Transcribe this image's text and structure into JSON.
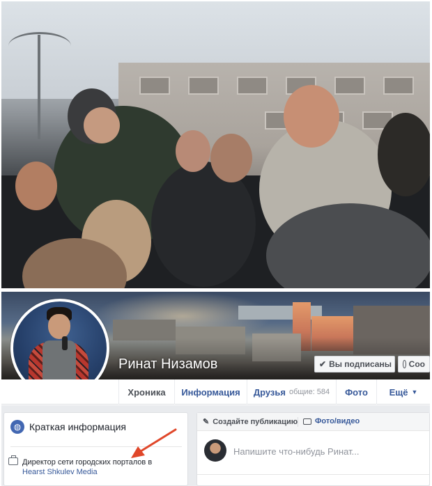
{
  "profile": {
    "name": "Ринат Низамов"
  },
  "cover_buttons": {
    "subscribed_label": "Вы подписаны",
    "message_label": "Соо"
  },
  "nav": {
    "items": [
      {
        "label": "Хроника"
      },
      {
        "label": "Информация"
      },
      {
        "label": "Друзья",
        "count": "общие: 584"
      },
      {
        "label": "Фото"
      },
      {
        "label": "Ещё"
      }
    ]
  },
  "intro": {
    "title": "Краткая информация",
    "work_prefix": "Директор сети городских порталов в",
    "work_company": "Hearst Shkulev Media"
  },
  "composer": {
    "create_post_label": "Создайте публикацию",
    "photo_video_label": "Фото/видео",
    "placeholder": "Напишите что-нибудь Ринат..."
  },
  "colors": {
    "link_blue": "#365899",
    "fb_blue": "#4267b2",
    "annotation_arrow": "#e0472a"
  },
  "icons": {
    "intro_icon": "globe-icon",
    "work_icon": "briefcase-icon",
    "create_post_icon": "pencil-icon",
    "photo_icon": "camera-icon",
    "subscribed_icon": "checkmark-icon",
    "message_icon": "messenger-icon"
  }
}
